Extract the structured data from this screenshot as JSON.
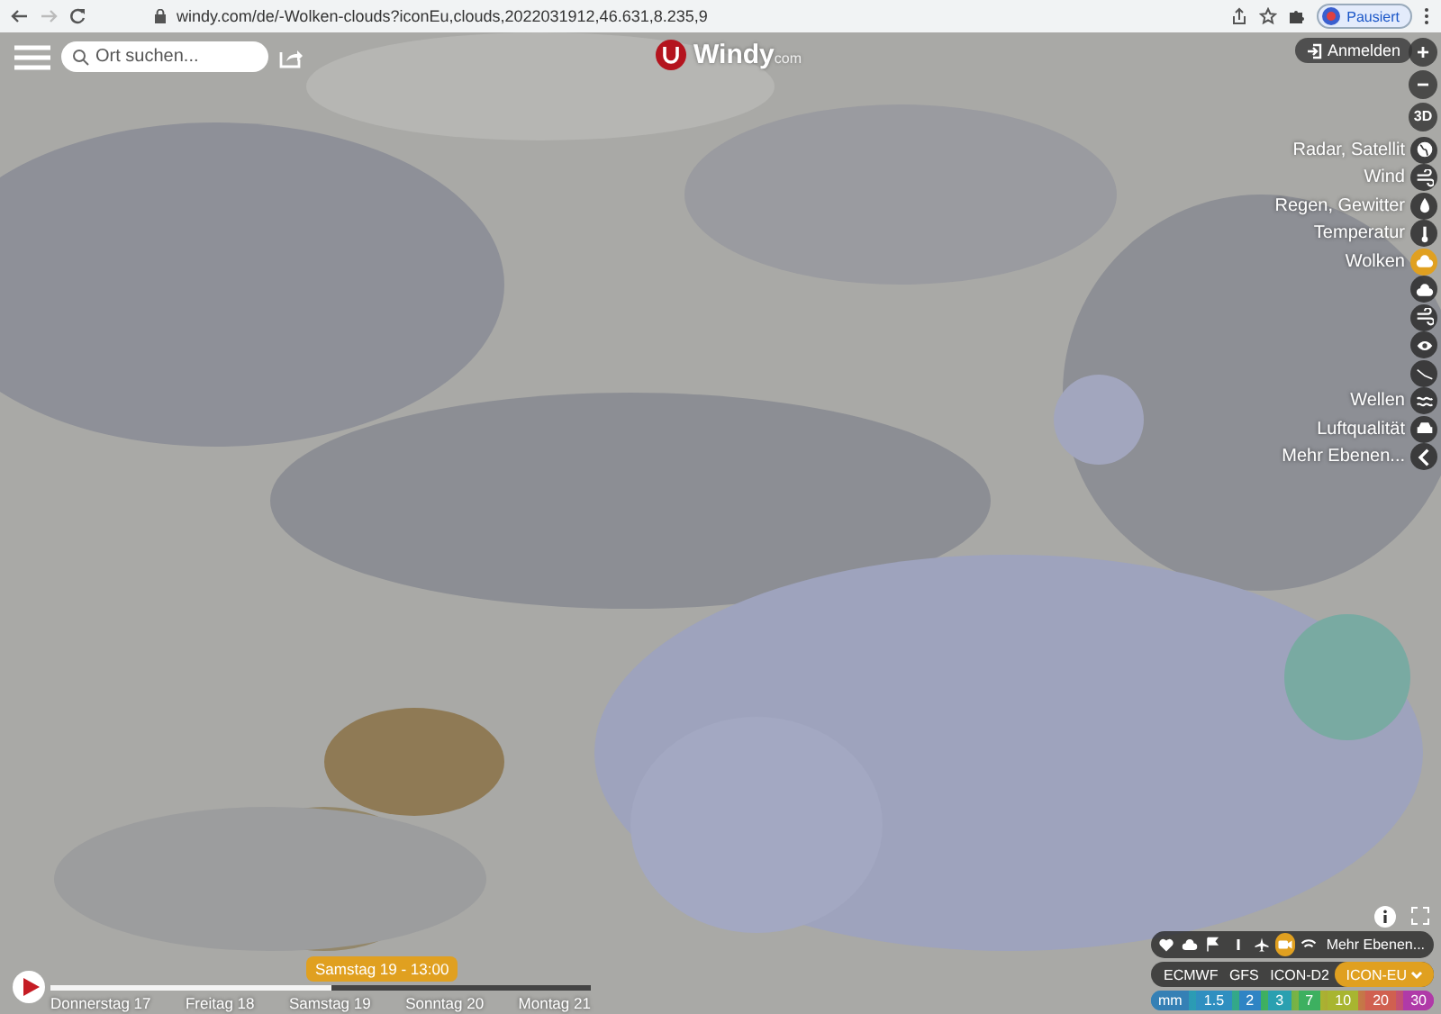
{
  "browser": {
    "url": "windy.com/de/-Wolken-clouds?iconEu,clouds,2022031912,46.631,8.235,9",
    "profile": "Pausiert"
  },
  "search": {
    "placeholder": "Ort suchen..."
  },
  "logo": {
    "name": "Windy",
    "suffix": "com"
  },
  "login": "Anmelden",
  "map_controls": {
    "plus": "+",
    "minus": "−",
    "view": "3D"
  },
  "layers": [
    {
      "label": "Radar, Satellit",
      "kind": "globe",
      "selected": false
    },
    {
      "label": "Wind",
      "kind": "wind",
      "selected": false
    },
    {
      "label": "Regen, Gewitter",
      "kind": "drop",
      "selected": false
    },
    {
      "label": "Temperatur",
      "kind": "thermometer",
      "selected": false
    },
    {
      "label": "Wolken",
      "kind": "cloud",
      "selected": true
    },
    {
      "kind": "cloud",
      "selected": false
    },
    {
      "kind": "wind",
      "selected": false
    },
    {
      "kind": "eye",
      "selected": false
    },
    {
      "kind": "line",
      "selected": false
    },
    {
      "label": "Wellen",
      "kind": "waves",
      "selected": false
    },
    {
      "label": "Luftqualität",
      "kind": "car",
      "selected": false
    },
    {
      "label": "Mehr Ebenen...",
      "kind": "chevron",
      "selected": false
    }
  ],
  "overlays": {
    "items": [
      {
        "kind": "heart",
        "selected": false
      },
      {
        "kind": "cloud",
        "selected": false
      },
      {
        "kind": "flag",
        "selected": false
      },
      {
        "kind": "bar",
        "selected": false
      },
      {
        "kind": "plane",
        "selected": false
      },
      {
        "kind": "camera",
        "selected": true
      },
      {
        "kind": "wifi",
        "selected": false
      }
    ],
    "more": "Mehr Ebenen..."
  },
  "models": [
    {
      "label": "ECMWF",
      "selected": false
    },
    {
      "label": "GFS",
      "selected": false
    },
    {
      "label": "ICON-D2",
      "selected": false
    },
    {
      "label": "ICON-EU",
      "selected": true
    }
  ],
  "legend": {
    "unit": "mm",
    "stops": [
      {
        "label": "1.5",
        "color": "#2f8fc0"
      },
      {
        "label": "2",
        "color": "#2f84c4"
      },
      {
        "label": "3",
        "color": "#2aa0b0"
      },
      {
        "label": "7",
        "color": "#3db060"
      },
      {
        "label": "10",
        "color": "#a8b530"
      },
      {
        "label": "20",
        "color": "#d06050"
      },
      {
        "label": "30",
        "color": "#b03aa8"
      }
    ]
  },
  "timeline": {
    "tooltip": "Samstag 19 - 13:00",
    "level": 0.52,
    "days": [
      "Donnerstag 17",
      "Freitag 18",
      "Samstag 19",
      "Sonntag 20",
      "Montag 21"
    ]
  }
}
